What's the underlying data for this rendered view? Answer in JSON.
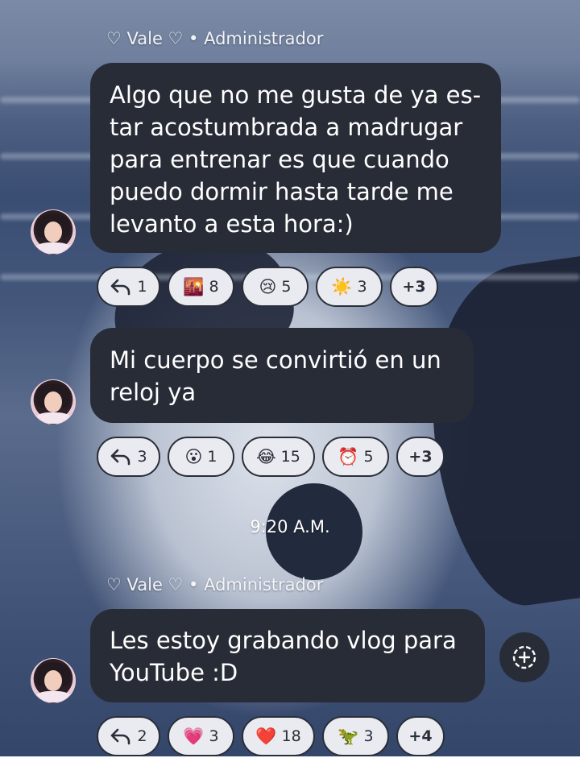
{
  "messages": [
    {
      "sender": "♡ Vale ♡ • Administrador",
      "lines": [
        "Algo que no me gusta de ya es-",
        "tar acostumbrada a madrugar",
        "para entrenar es que cuando",
        "puedo dormir hasta tarde me",
        "levanto a esta hora:)"
      ],
      "reactions": [
        {
          "icon": "reply-icon",
          "emoji": "",
          "count": "1"
        },
        {
          "icon": "city-sunset-icon",
          "emoji": "🌇",
          "count": "8"
        },
        {
          "icon": "crying-face-icon",
          "emoji": "😢",
          "count": "5"
        },
        {
          "icon": "sun-icon",
          "emoji": "☀️",
          "count": "3"
        }
      ],
      "more": "+3"
    },
    {
      "sender": "",
      "lines": [
        "Mi cuerpo se convirtió en un",
        "reloj ya"
      ],
      "reactions": [
        {
          "icon": "reply-icon",
          "emoji": "",
          "count": "3"
        },
        {
          "icon": "surprised-face-icon",
          "emoji": "😮",
          "count": "1"
        },
        {
          "icon": "laughing-tears-icon",
          "emoji": "😂",
          "count": "15"
        },
        {
          "icon": "alarm-clock-icon",
          "emoji": "⏰",
          "count": "5"
        }
      ],
      "more": "+3"
    },
    {
      "sender": "♡ Vale ♡ • Administrador",
      "lines": [
        "Les estoy grabando vlog para",
        "YouTube :D"
      ],
      "reactions": [
        {
          "icon": "reply-icon",
          "emoji": "",
          "count": "2"
        },
        {
          "icon": "pink-heart-icon",
          "emoji": "💗",
          "count": "3"
        },
        {
          "icon": "red-heart-icon",
          "emoji": "❤️",
          "count": "18"
        },
        {
          "icon": "dinosaur-icon",
          "emoji": "🦖",
          "count": "3"
        }
      ],
      "more": "+4"
    }
  ],
  "timestamp": "9:20 A.M.",
  "colors": {
    "bubble": "#282c37",
    "chip": "#e9ebf1",
    "chip_text": "#2a2e38"
  }
}
